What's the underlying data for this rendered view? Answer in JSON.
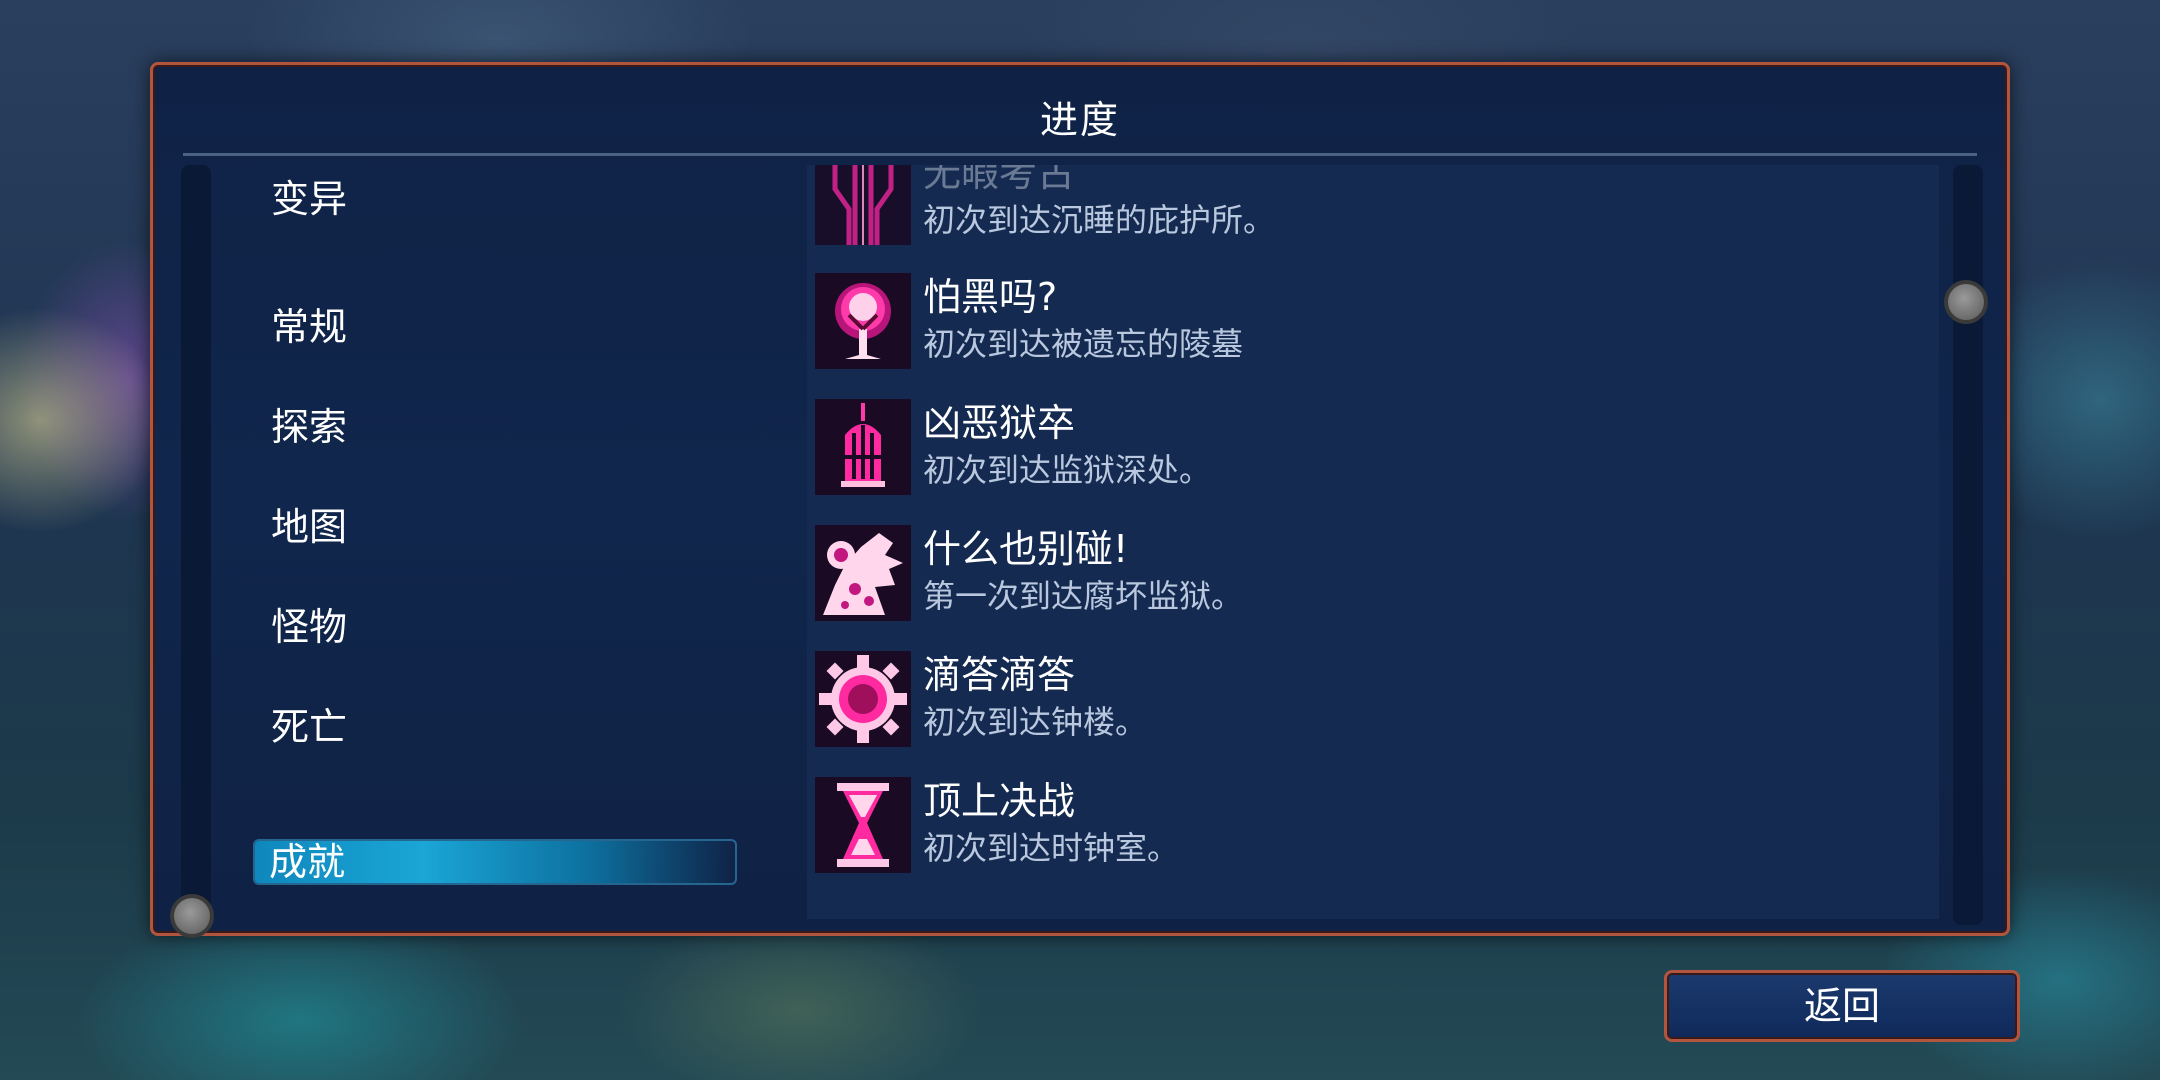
{
  "panel": {
    "title": "进度"
  },
  "categories": [
    {
      "label": "变异",
      "active": false
    },
    {
      "label": "常规",
      "active": false
    },
    {
      "label": "探索",
      "active": false
    },
    {
      "label": "地图",
      "active": false
    },
    {
      "label": "怪物",
      "active": false
    },
    {
      "label": "死亡",
      "active": false
    },
    {
      "label": "成就",
      "active": true
    }
  ],
  "achievements": [
    {
      "name": "无暇考古",
      "description": "初次到达沉睡的庇护所。",
      "icon": "pillars-icon"
    },
    {
      "name": "怕黑吗?",
      "description": "初次到达被遗忘的陵墓",
      "icon": "tree-icon"
    },
    {
      "name": "凶恶狱卒",
      "description": "初次到达监狱深处。",
      "icon": "cage-icon"
    },
    {
      "name": "什么也别碰!",
      "description": "第一次到达腐坏监狱。",
      "icon": "rot-creature-icon"
    },
    {
      "name": "滴答滴答",
      "description": "初次到达钟楼。",
      "icon": "gear-icon"
    },
    {
      "name": "顶上决战",
      "description": "初次到达时钟室。",
      "icon": "hourglass-icon"
    }
  ],
  "footer": {
    "back_label": "返回"
  },
  "colors": {
    "accent_border": "#b2553f",
    "panel_bg": "#0f2246",
    "active_tab": "#1aa6d6",
    "icon_glow": "#ff2aa0"
  }
}
